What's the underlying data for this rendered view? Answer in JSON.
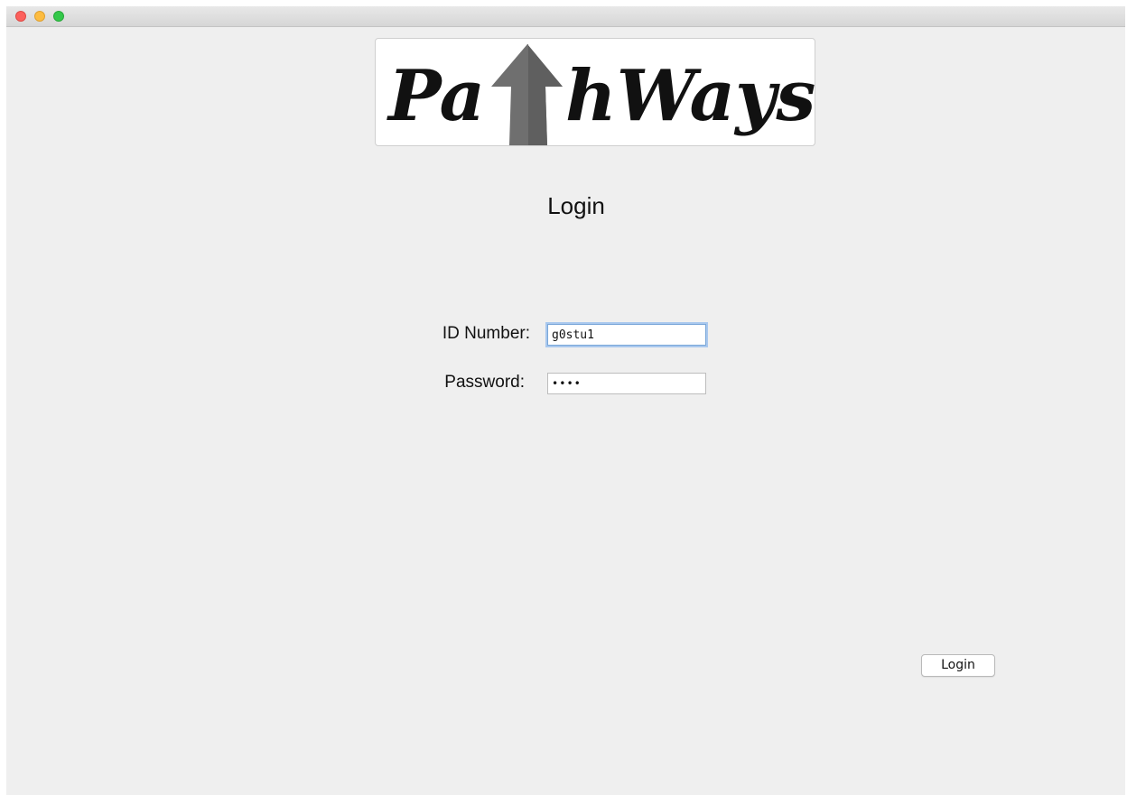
{
  "window": {
    "controls": [
      "close",
      "minimize",
      "maximize"
    ]
  },
  "logo": {
    "text_left": "Pa",
    "text_right": "hWays",
    "arrow_icon": "up-arrow-icon"
  },
  "page": {
    "title": "Login"
  },
  "form": {
    "id_label": "ID Number:",
    "id_value": "g0stu1",
    "password_label": "Password:",
    "password_value": "••••"
  },
  "actions": {
    "login_label": "Login"
  },
  "colors": {
    "background": "#efefef",
    "focus_ring": "#a9c8ee",
    "close": "#fc605c",
    "minimize": "#fdbc40",
    "maximize": "#34c84a"
  }
}
